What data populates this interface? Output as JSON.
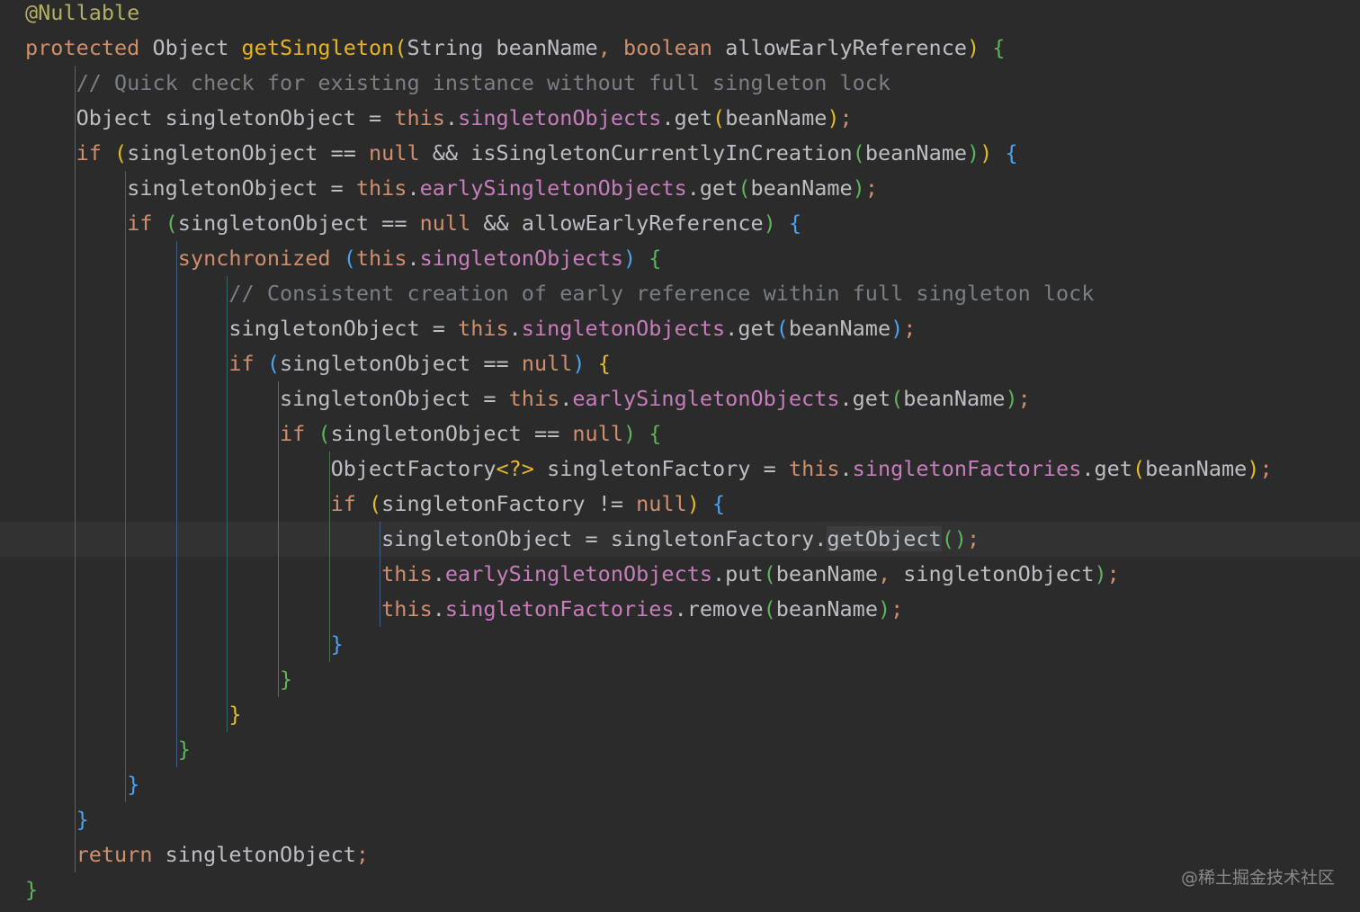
{
  "colors": {
    "background": "#2b2b2b",
    "caret_line": "#323232",
    "keyword": "#cf8e6d",
    "annotation": "#b3ae60",
    "method_decl": "#e6b422",
    "field": "#c77dbb",
    "comment": "#7a7e85",
    "plain": "#bcbec4",
    "brace_l1": "#5fb35a",
    "brace_l2": "#4aa3f2",
    "brace_l3": "#e3bc2b",
    "guide_l1": "#4d6f4e",
    "guide_l2": "#3f5d86",
    "guide_l3": "#7a6a2a",
    "guide_l4": "#2f6b61"
  },
  "gutter_icon": "lightbulb-icon",
  "watermark": "@稀土掘金技术社区",
  "lines": [
    [
      {
        "t": "@Nullable",
        "c": "annotation"
      }
    ],
    [
      {
        "t": "protected ",
        "c": "keyword"
      },
      {
        "t": "Object ",
        "c": "plain"
      },
      {
        "t": "getSingleton",
        "c": "method_decl"
      },
      {
        "t": "(",
        "c": "brace_l3"
      },
      {
        "t": "String beanName",
        "c": "plain"
      },
      {
        "t": ", ",
        "c": "keyword"
      },
      {
        "t": "boolean ",
        "c": "keyword"
      },
      {
        "t": "allowEarlyReference",
        "c": "plain"
      },
      {
        "t": ") ",
        "c": "brace_l3"
      },
      {
        "t": "{",
        "c": "brace_l1"
      }
    ],
    [
      {
        "t": "    ",
        "c": "plain"
      },
      {
        "t": "// Quick check for existing instance without full singleton lock",
        "c": "comment"
      }
    ],
    [
      {
        "t": "    ",
        "c": "plain"
      },
      {
        "t": "Object singletonObject = ",
        "c": "plain"
      },
      {
        "t": "this",
        "c": "keyword"
      },
      {
        "t": ".",
        "c": "plain"
      },
      {
        "t": "singletonObjects",
        "c": "field"
      },
      {
        "t": ".get",
        "c": "plain"
      },
      {
        "t": "(",
        "c": "brace_l3"
      },
      {
        "t": "beanName",
        "c": "plain"
      },
      {
        "t": ")",
        "c": "brace_l3"
      },
      {
        "t": ";",
        "c": "keyword"
      }
    ],
    [
      {
        "t": "    ",
        "c": "plain"
      },
      {
        "t": "if ",
        "c": "keyword"
      },
      {
        "t": "(",
        "c": "brace_l3"
      },
      {
        "t": "singletonObject == ",
        "c": "plain"
      },
      {
        "t": "null ",
        "c": "keyword"
      },
      {
        "t": "&& isSingletonCurrentlyInCreation",
        "c": "plain"
      },
      {
        "t": "(",
        "c": "brace_l1"
      },
      {
        "t": "beanName",
        "c": "plain"
      },
      {
        "t": ")",
        "c": "brace_l1"
      },
      {
        "t": ") ",
        "c": "brace_l3"
      },
      {
        "t": "{",
        "c": "brace_l2"
      }
    ],
    [
      {
        "t": "        ",
        "c": "plain"
      },
      {
        "t": "singletonObject = ",
        "c": "plain"
      },
      {
        "t": "this",
        "c": "keyword"
      },
      {
        "t": ".",
        "c": "plain"
      },
      {
        "t": "earlySingletonObjects",
        "c": "field"
      },
      {
        "t": ".get",
        "c": "plain"
      },
      {
        "t": "(",
        "c": "brace_l1"
      },
      {
        "t": "beanName",
        "c": "plain"
      },
      {
        "t": ")",
        "c": "brace_l1"
      },
      {
        "t": ";",
        "c": "keyword"
      }
    ],
    [
      {
        "t": "        ",
        "c": "plain"
      },
      {
        "t": "if ",
        "c": "keyword"
      },
      {
        "t": "(",
        "c": "brace_l1"
      },
      {
        "t": "singletonObject == ",
        "c": "plain"
      },
      {
        "t": "null ",
        "c": "keyword"
      },
      {
        "t": "&& allowEarlyReference",
        "c": "plain"
      },
      {
        "t": ") ",
        "c": "brace_l1"
      },
      {
        "t": "{",
        "c": "brace_l2"
      }
    ],
    [
      {
        "t": "            ",
        "c": "plain"
      },
      {
        "t": "synchronized ",
        "c": "keyword"
      },
      {
        "t": "(",
        "c": "brace_l2"
      },
      {
        "t": "this",
        "c": "keyword"
      },
      {
        "t": ".",
        "c": "plain"
      },
      {
        "t": "singletonObjects",
        "c": "field"
      },
      {
        "t": ") ",
        "c": "brace_l2"
      },
      {
        "t": "{",
        "c": "brace_l1"
      }
    ],
    [
      {
        "t": "                ",
        "c": "plain"
      },
      {
        "t": "// Consistent creation of early reference within full singleton lock",
        "c": "comment"
      }
    ],
    [
      {
        "t": "                ",
        "c": "plain"
      },
      {
        "t": "singletonObject = ",
        "c": "plain"
      },
      {
        "t": "this",
        "c": "keyword"
      },
      {
        "t": ".",
        "c": "plain"
      },
      {
        "t": "singletonObjects",
        "c": "field"
      },
      {
        "t": ".get",
        "c": "plain"
      },
      {
        "t": "(",
        "c": "brace_l2"
      },
      {
        "t": "beanName",
        "c": "plain"
      },
      {
        "t": ")",
        "c": "brace_l2"
      },
      {
        "t": ";",
        "c": "keyword"
      }
    ],
    [
      {
        "t": "                ",
        "c": "plain"
      },
      {
        "t": "if ",
        "c": "keyword"
      },
      {
        "t": "(",
        "c": "brace_l2"
      },
      {
        "t": "singletonObject == ",
        "c": "plain"
      },
      {
        "t": "null",
        "c": "keyword"
      },
      {
        "t": ") ",
        "c": "brace_l2"
      },
      {
        "t": "{",
        "c": "brace_l3"
      }
    ],
    [
      {
        "t": "                    ",
        "c": "plain"
      },
      {
        "t": "singletonObject = ",
        "c": "plain"
      },
      {
        "t": "this",
        "c": "keyword"
      },
      {
        "t": ".",
        "c": "plain"
      },
      {
        "t": "earlySingletonObjects",
        "c": "field"
      },
      {
        "t": ".get",
        "c": "plain"
      },
      {
        "t": "(",
        "c": "brace_l1"
      },
      {
        "t": "beanName",
        "c": "plain"
      },
      {
        "t": ")",
        "c": "brace_l1"
      },
      {
        "t": ";",
        "c": "keyword"
      }
    ],
    [
      {
        "t": "                    ",
        "c": "plain"
      },
      {
        "t": "if ",
        "c": "keyword"
      },
      {
        "t": "(",
        "c": "brace_l1"
      },
      {
        "t": "singletonObject == ",
        "c": "plain"
      },
      {
        "t": "null",
        "c": "keyword"
      },
      {
        "t": ") ",
        "c": "brace_l1"
      },
      {
        "t": "{",
        "c": "brace_l1"
      }
    ],
    [
      {
        "t": "                        ",
        "c": "plain"
      },
      {
        "t": "ObjectFactory",
        "c": "plain"
      },
      {
        "t": "<?>",
        "c": "brace_l3"
      },
      {
        "t": " singletonFactory = ",
        "c": "plain"
      },
      {
        "t": "this",
        "c": "keyword"
      },
      {
        "t": ".",
        "c": "plain"
      },
      {
        "t": "singletonFactories",
        "c": "field"
      },
      {
        "t": ".get",
        "c": "plain"
      },
      {
        "t": "(",
        "c": "brace_l3"
      },
      {
        "t": "beanName",
        "c": "plain"
      },
      {
        "t": ")",
        "c": "brace_l3"
      },
      {
        "t": ";",
        "c": "keyword"
      }
    ],
    [
      {
        "t": "                        ",
        "c": "plain"
      },
      {
        "t": "if ",
        "c": "keyword"
      },
      {
        "t": "(",
        "c": "brace_l3"
      },
      {
        "t": "singletonFactory != ",
        "c": "plain"
      },
      {
        "t": "null",
        "c": "keyword"
      },
      {
        "t": ") ",
        "c": "brace_l3"
      },
      {
        "t": "{",
        "c": "brace_l2"
      }
    ],
    [
      {
        "t": "                            ",
        "c": "plain"
      },
      {
        "t": "singletonObject = singletonFactory.",
        "c": "plain"
      },
      {
        "t": "getObject",
        "c": "plain",
        "hl": true
      },
      {
        "t": "()",
        "c": "brace_l1"
      },
      {
        "t": ";",
        "c": "keyword"
      }
    ],
    [
      {
        "t": "                            ",
        "c": "plain"
      },
      {
        "t": "this",
        "c": "keyword"
      },
      {
        "t": ".",
        "c": "plain"
      },
      {
        "t": "earlySingletonObjects",
        "c": "field"
      },
      {
        "t": ".put",
        "c": "plain"
      },
      {
        "t": "(",
        "c": "brace_l1"
      },
      {
        "t": "beanName",
        "c": "plain"
      },
      {
        "t": ", ",
        "c": "keyword"
      },
      {
        "t": "singletonObject",
        "c": "plain"
      },
      {
        "t": ")",
        "c": "brace_l1"
      },
      {
        "t": ";",
        "c": "keyword"
      }
    ],
    [
      {
        "t": "                            ",
        "c": "plain"
      },
      {
        "t": "this",
        "c": "keyword"
      },
      {
        "t": ".",
        "c": "plain"
      },
      {
        "t": "singletonFactories",
        "c": "field"
      },
      {
        "t": ".remove",
        "c": "plain"
      },
      {
        "t": "(",
        "c": "brace_l1"
      },
      {
        "t": "beanName",
        "c": "plain"
      },
      {
        "t": ")",
        "c": "brace_l1"
      },
      {
        "t": ";",
        "c": "keyword"
      }
    ],
    [
      {
        "t": "                        ",
        "c": "plain"
      },
      {
        "t": "}",
        "c": "brace_l2"
      }
    ],
    [
      {
        "t": "                    ",
        "c": "plain"
      },
      {
        "t": "}",
        "c": "brace_l1"
      }
    ],
    [
      {
        "t": "                ",
        "c": "plain"
      },
      {
        "t": "}",
        "c": "brace_l3"
      }
    ],
    [
      {
        "t": "            ",
        "c": "plain"
      },
      {
        "t": "}",
        "c": "brace_l1"
      }
    ],
    [
      {
        "t": "        ",
        "c": "plain"
      },
      {
        "t": "}",
        "c": "brace_l2"
      }
    ],
    [
      {
        "t": "    ",
        "c": "plain"
      },
      {
        "t": "}",
        "c": "brace_l2"
      }
    ],
    [
      {
        "t": "    ",
        "c": "plain"
      },
      {
        "t": "return ",
        "c": "keyword"
      },
      {
        "t": "singletonObject",
        "c": "plain"
      },
      {
        "t": ";",
        "c": "keyword"
      }
    ],
    [
      {
        "t": "}",
        "c": "brace_l1"
      }
    ]
  ]
}
